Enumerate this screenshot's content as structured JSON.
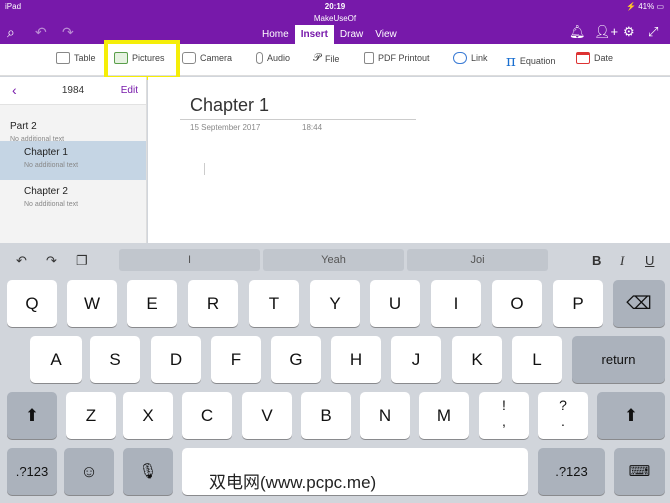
{
  "status": {
    "device": "iPad",
    "time": "20:19",
    "battery": "41%"
  },
  "app": {
    "title": "MakeUseOf"
  },
  "tabs": [
    {
      "label": "Home",
      "active": false
    },
    {
      "label": "Insert",
      "active": true
    },
    {
      "label": "Draw",
      "active": false
    },
    {
      "label": "View",
      "active": false
    }
  ],
  "ribbon": [
    {
      "label": "Table",
      "icon": "table-icon"
    },
    {
      "label": "Pictures",
      "icon": "pictures-icon"
    },
    {
      "label": "Camera",
      "icon": "camera-icon"
    },
    {
      "label": "Audio",
      "icon": "microphone-icon"
    },
    {
      "label": "File",
      "icon": "paperclip-icon"
    },
    {
      "label": "PDF Printout",
      "icon": "pdf-icon"
    },
    {
      "label": "Link",
      "icon": "link-icon"
    },
    {
      "label": "Equation",
      "icon": "pi-icon"
    },
    {
      "label": "Date",
      "icon": "calendar-icon"
    }
  ],
  "sidebar": {
    "notebook": "1984",
    "edit": "Edit",
    "section": {
      "title": "Part 2",
      "subtitle": "No additional text"
    },
    "pages": [
      {
        "title": "Chapter 1",
        "subtitle": "No additional text"
      },
      {
        "title": "Chapter 2",
        "subtitle": "No additional text"
      }
    ]
  },
  "page": {
    "title": "Chapter 1",
    "date": "15 September 2017",
    "time": "18:44"
  },
  "keyboard": {
    "suggestions": [
      "I",
      "Yeah",
      "Joi"
    ],
    "format": {
      "bold": "B",
      "italic": "I",
      "underline": "U"
    },
    "row1": [
      "Q",
      "W",
      "E",
      "R",
      "T",
      "Y",
      "U",
      "I",
      "O",
      "P"
    ],
    "row2": [
      "A",
      "S",
      "D",
      "F",
      "G",
      "H",
      "J",
      "K",
      "L"
    ],
    "row3": [
      "Z",
      "X",
      "C",
      "V",
      "B",
      "N",
      "M"
    ],
    "return_label": "return",
    "num_label": ".?123",
    "punct1_top": "!",
    "punct1_bot": ",",
    "punct2_top": "?",
    "punct2_bot": "."
  },
  "watermark": "双电网(www.pcpc.me)",
  "colors": {
    "brand": "#7719aa",
    "highlight": "#f5ee08",
    "selected_page": "#c5d5e4"
  }
}
